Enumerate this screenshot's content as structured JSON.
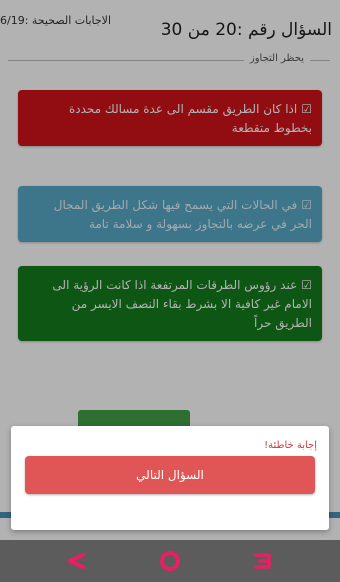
{
  "header": {
    "question_number": "السؤال رقم :20 من 30",
    "correct_answers": "الاجابات الصحيحة :6/19"
  },
  "section_label": "يحظر التجاوز",
  "options": [
    {
      "text": "اذا كان الطريق مقسم الى عدة مسالك محددة بخطوط متقطعة",
      "color": "#d2131b",
      "state": "wrong"
    },
    {
      "text": "في الحالات التي يسمح فيها شكل الطريق المجال الحر في عرضه بالتجاوز بسهولة و سلامة تامة",
      "color": "#58a8c6",
      "state": "neutral"
    },
    {
      "text": "عند رؤوس الطرقات المرتفعة اذا كانت الرؤية الى الامام غير كافية الا بشرط بقاء النصف الايسر من الطريق حراً",
      "color": "#137c1d",
      "state": "correct"
    }
  ],
  "dialog": {
    "message": "إجابة خاطئة!",
    "next_button": "السؤال التالي",
    "button_color": "#e05555"
  },
  "navbar": {
    "icons": [
      "back-icon",
      "home-icon",
      "recent-apps-icon"
    ],
    "icon_color": "#e91e63"
  }
}
